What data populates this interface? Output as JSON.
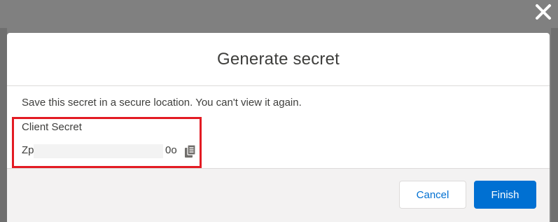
{
  "modal": {
    "title": "Generate secret",
    "info_text": "Save this secret in a secure location. You can't view it again.",
    "secret_label": "Client Secret",
    "secret_start": "Zp",
    "secret_end": "0o"
  },
  "footer": {
    "cancel_label": "Cancel",
    "finish_label": "Finish"
  },
  "icons": {
    "close": "close-icon",
    "copy": "copy-icon"
  },
  "colors": {
    "brand_blue": "#0070d2",
    "highlight_red": "#e31b23",
    "overlay_gray": "#808080"
  }
}
